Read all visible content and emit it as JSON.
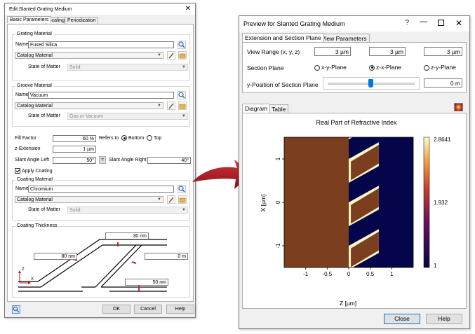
{
  "left_dialog": {
    "title": "Edit Slanted Grating Medium",
    "tabs": [
      "Basic Parameters",
      "Scaling",
      "Periodization"
    ],
    "grating_material": {
      "label": "Grating Material",
      "name_label": "Name",
      "name_value": "Fused Silica",
      "catalog": "Catalog Material",
      "state_label": "State of Matter",
      "state_value": "Solid"
    },
    "groove_material": {
      "label": "Groove Material",
      "name_label": "Name",
      "name_value": "Vacuum",
      "catalog": "Catalog Material",
      "state_label": "State of Matter",
      "state_value": "Gas or Vacuum"
    },
    "fill_factor": {
      "label": "Fill Factor",
      "value": "60 %",
      "refers_label": "Refers to ...",
      "bottom": "Bottom",
      "top": "Top"
    },
    "z_extension": {
      "label": "z-Extension",
      "value": "1 µm"
    },
    "slant_left": {
      "label": "Slant Angle Left",
      "value": "50°",
      "link": "="
    },
    "slant_right": {
      "label": "Slant Angle Right",
      "value": "40°"
    },
    "apply_coating": "Apply Coating",
    "coating_material": {
      "label": "Coating Material",
      "name_label": "Name",
      "name_value": "Chromium",
      "catalog": "Catalog Material",
      "state_label": "State of Matter",
      "state_value": "Solid"
    },
    "coating_thickness": {
      "label": "Coating Thickness",
      "top": "30 nm",
      "left": "80 nm",
      "right": "0 m",
      "bottom": "50 nm",
      "axis_z": "Z",
      "axis_x": "X"
    },
    "buttons": {
      "ok": "OK",
      "cancel": "Cancel",
      "help": "Help"
    }
  },
  "right_dialog": {
    "title": "Preview for Slanted Grating Medium",
    "tabs": [
      "Extension and Section Plane",
      "View Parameters"
    ],
    "view_range": {
      "label": "View Range (x, y, z)",
      "x": "3 µm",
      "y": "3 µm",
      "z": "3 µm"
    },
    "section_plane": {
      "label": "Section Plane",
      "options": [
        "x-y-Plane",
        "z-x-Plane",
        "z-y-Plane"
      ],
      "selected": 1
    },
    "y_position": {
      "label": "y-Position of Section Plane",
      "value": "0 m"
    },
    "subtabs": [
      "Diagram",
      "Table"
    ],
    "buttons": {
      "close": "Close",
      "help": "Help"
    }
  },
  "chart_data": {
    "type": "heatmap",
    "title": "Real Part of Refractive Index",
    "xlabel": "Z [µm]",
    "ylabel": "X [µm]",
    "xticks": [
      "-1",
      "-0.5",
      "0",
      "0.5",
      "1"
    ],
    "yticks": [
      "-1",
      "0",
      "1"
    ],
    "xlim": [
      -1.5,
      1.5
    ],
    "ylim": [
      -1.5,
      1.5
    ],
    "colorbar": {
      "max": "2.8641",
      "mid": "1.932",
      "min": "1"
    },
    "colors": {
      "silica": "#7b3f1f",
      "vacuum": "#04054a",
      "coating": "#f8f4c6"
    }
  }
}
